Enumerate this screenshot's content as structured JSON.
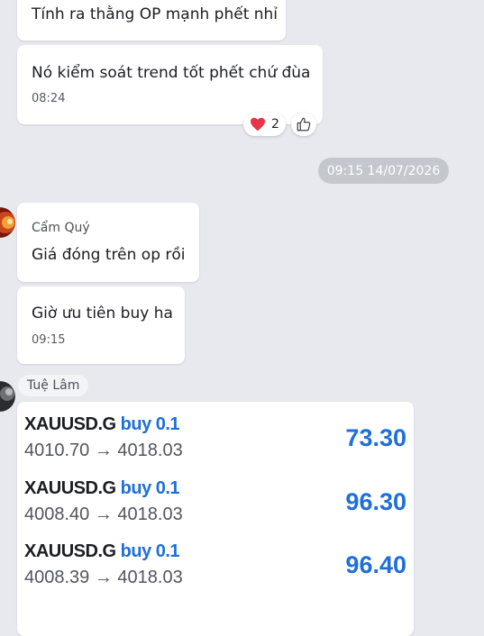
{
  "messages": {
    "m1": {
      "text": "Tính ra thằng OP mạnh phết nhỉ"
    },
    "m2": {
      "text": "Nó kiểm soát trend tốt phết chứ đùa",
      "time": "08:24",
      "reaction_count": "2"
    },
    "date_divider": "09:15 14/07/2026",
    "m3": {
      "sender": "Cẩm Quý",
      "text": "Giá đóng trên op rồi"
    },
    "m4": {
      "text": "Giờ ưu tiên buy ha",
      "time": "09:15"
    },
    "m5": {
      "sender": "Tuệ Lâm",
      "trades": [
        {
          "symbol": "XAUUSD.G",
          "side": "buy 0.1",
          "prices": "4010.70 → 4018.03",
          "profit": "73.30"
        },
        {
          "symbol": "XAUUSD.G",
          "side": "buy 0.1",
          "prices": "4008.40 → 4018.03",
          "profit": "96.30"
        },
        {
          "symbol": "XAUUSD.G",
          "side": "buy 0.1",
          "prices": "4008.39 → 4018.03",
          "profit": "96.40"
        }
      ]
    }
  },
  "colors": {
    "background": "#e8e9ee",
    "accent_blue": "#1e6fd9",
    "date_pill": "#c4c7cd"
  },
  "icons": [
    "heart-icon",
    "thumbs-up-icon"
  ]
}
